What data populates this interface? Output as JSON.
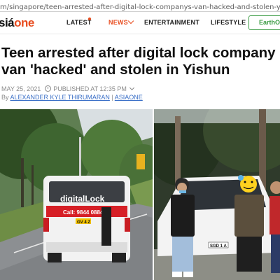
{
  "browser": {
    "url": "m/singapore/teen-arrested-after-digital-lock-companys-van-hacked-and-stolen-yishun?utm_medium=Social"
  },
  "nav": {
    "logo_prefix": "siá",
    "logo_brand": "one",
    "items": [
      {
        "label": "LATEST"
      },
      {
        "label": "NEWS"
      },
      {
        "label": "ENTERTAINMENT"
      },
      {
        "label": "LIFESTYLE"
      }
    ],
    "earth_button": "EarthO",
    "accent_color": "#e84c1f",
    "earth_color": "#3a9b43"
  },
  "article": {
    "title_line1": "Teen arrested after digital lock company",
    "title_line2": "van 'hacked' and stolen in Yishun",
    "date": "MAY 25, 2021",
    "published": "PUBLISHED AT 12:35 PM",
    "by": "By",
    "author": "ALEXANDER KYLE THIRUMARAN",
    "separator": "|",
    "source": "ASIAONE"
  },
  "images": {
    "left": {
      "van_brand": "digitalLock",
      "van_phone": "Call: 9844 0884",
      "van_plate": "GV 4 Z"
    },
    "right": {
      "car_plate": "SGD 1 A"
    }
  }
}
